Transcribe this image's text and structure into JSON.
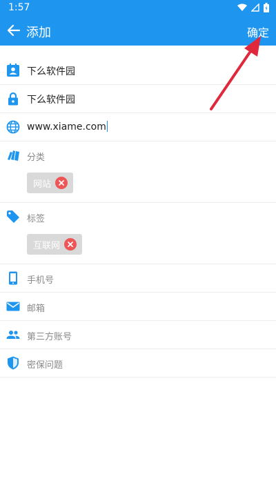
{
  "status_bar": {
    "time": "1:57",
    "icons": [
      "wifi-icon",
      "signal-icon",
      "battery-icon"
    ]
  },
  "app_bar": {
    "back_icon": "arrow-left-icon",
    "title": "添加",
    "confirm_label": "确定"
  },
  "form": {
    "name": {
      "icon": "badge-icon",
      "value": "下么软件园"
    },
    "password": {
      "icon": "lock-icon",
      "value": "下么软件园"
    },
    "website": {
      "icon": "globe-icon",
      "value": "www.xiame.com"
    },
    "category": {
      "icon": "cards-icon",
      "placeholder": "分类",
      "chips": [
        {
          "label": "网站"
        }
      ]
    },
    "tags": {
      "icon": "tag-icon",
      "placeholder": "标签",
      "chips": [
        {
          "label": "互联网"
        }
      ]
    },
    "phone": {
      "icon": "phone-icon",
      "placeholder": "手机号"
    },
    "email": {
      "icon": "mail-icon",
      "placeholder": "邮箱"
    },
    "third_party": {
      "icon": "people-icon",
      "placeholder": "第三方账号"
    },
    "security_question": {
      "icon": "shield-icon",
      "placeholder": "密保问题"
    }
  },
  "colors": {
    "primary": "#1e96f0",
    "chip_bg": "#d9d9d9",
    "chip_close": "#ee5555",
    "annotation_arrow": "#e0283c"
  }
}
